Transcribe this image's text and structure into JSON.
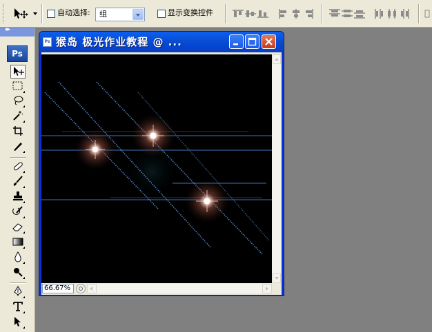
{
  "options_bar": {
    "auto_select_label": "自动选择:",
    "auto_select_value": "组",
    "show_transform_label": "显示变换控件",
    "tool_preset_icon": "move-tool-icon"
  },
  "toolbox": {
    "logo": "Ps",
    "tools": [
      "move-tool-icon",
      "marquee-tool-icon",
      "lasso-tool-icon",
      "magic-wand-tool-icon",
      "crop-tool-icon",
      "slice-tool-icon",
      "healing-brush-tool-icon",
      "brush-tool-icon",
      "clone-stamp-tool-icon",
      "history-brush-tool-icon",
      "eraser-tool-icon",
      "gradient-tool-icon",
      "blur-tool-icon",
      "dodge-tool-icon",
      "pen-tool-icon",
      "type-tool-icon",
      "path-selection-tool-icon"
    ]
  },
  "document": {
    "title": "猴岛  极光作业教程 @ ...",
    "zoom": "66.67%",
    "canvas_background": "#000000",
    "flare_color": "#ffd9c8",
    "streak_color": "#4a7fc0"
  }
}
